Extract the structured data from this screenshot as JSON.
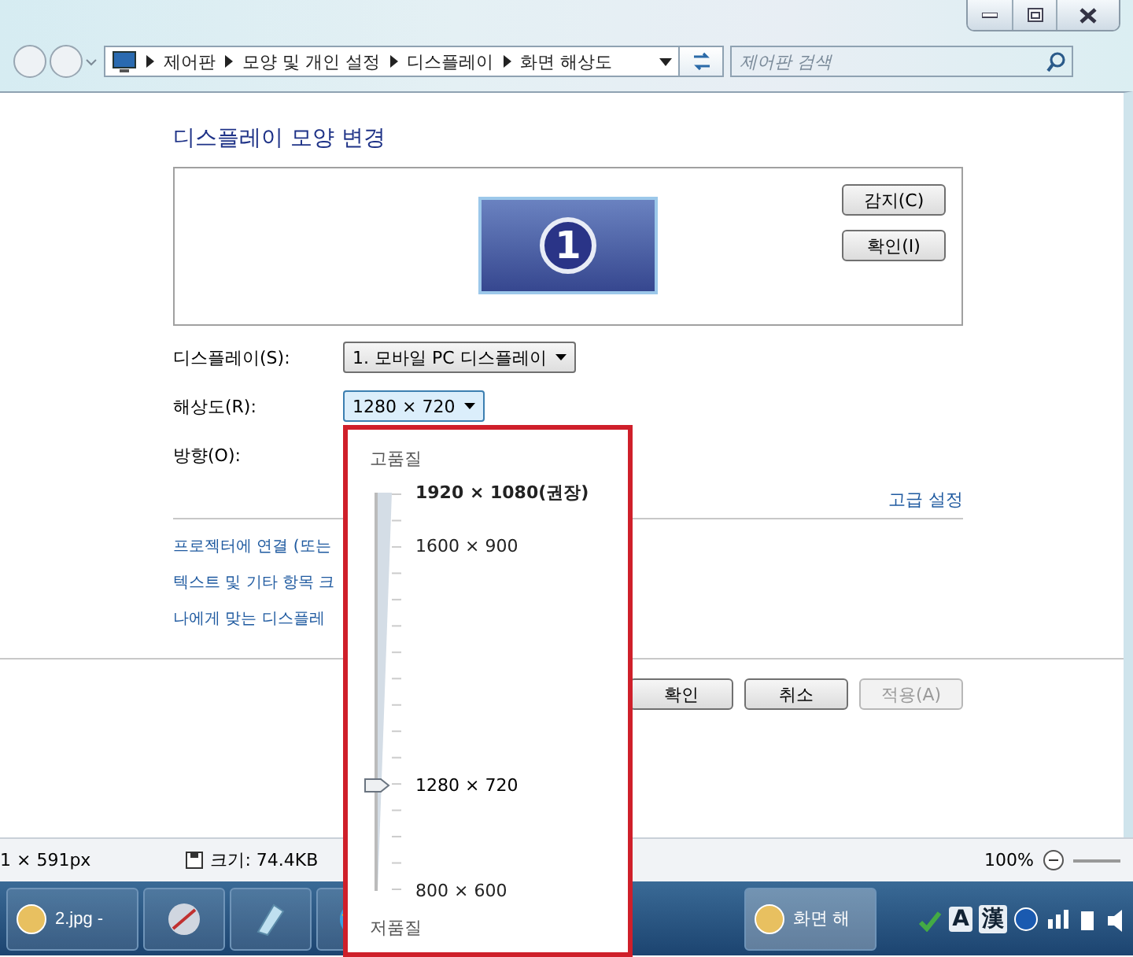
{
  "address_bar": {
    "breadcrumbs": [
      "제어판",
      "모양 및 개인 설정",
      "디스플레이",
      "화면 해상도"
    ]
  },
  "search": {
    "placeholder": "제어판 검색"
  },
  "heading": "디스플레이 모양 변경",
  "preview": {
    "monitor_number": "1",
    "buttons": [
      "감지(C)",
      "확인(I)"
    ]
  },
  "display_select": {
    "label": "디스플레이(S):",
    "value": "1. 모바일 PC 디스플레이"
  },
  "resolution_select": {
    "label": "해상도(R):",
    "value": "1280 × 720",
    "expanded": true
  },
  "orientation_label": "방향(O):",
  "advanced_link": "고급 설정",
  "links": [
    "프로젝터에 연결 (또는",
    "텍스트 및 기타 항목 크",
    "나에게 맞는 디스플레"
  ],
  "dialog_buttons": [
    {
      "label": "확인",
      "disabled": false
    },
    {
      "label": "취소",
      "disabled": false
    },
    {
      "label": "적용(A)",
      "disabled": true
    }
  ],
  "resolution_popup": {
    "top_label": "고품질",
    "bottom_label": "저품질",
    "level": 0.265,
    "options": [
      {
        "label": "1920 × 1080(권장)",
        "recommended": true,
        "selected": false
      },
      {
        "label": "1600 × 900",
        "recommended": false,
        "selected": false
      },
      {
        "label": "1280 × 720",
        "recommended": false,
        "selected": true
      },
      {
        "label": "800 × 600",
        "recommended": false,
        "selected": false
      }
    ]
  },
  "status_bar": {
    "dimensions": "1 × 591px",
    "file_size": "크기: 74.4KB",
    "zoom": "100%"
  },
  "taskbar": {
    "items": [
      {
        "label": "2.jpg -",
        "selected": false
      },
      {
        "label": "화면 해",
        "selected": true
      }
    ],
    "tray": [
      "A",
      "漢"
    ]
  }
}
